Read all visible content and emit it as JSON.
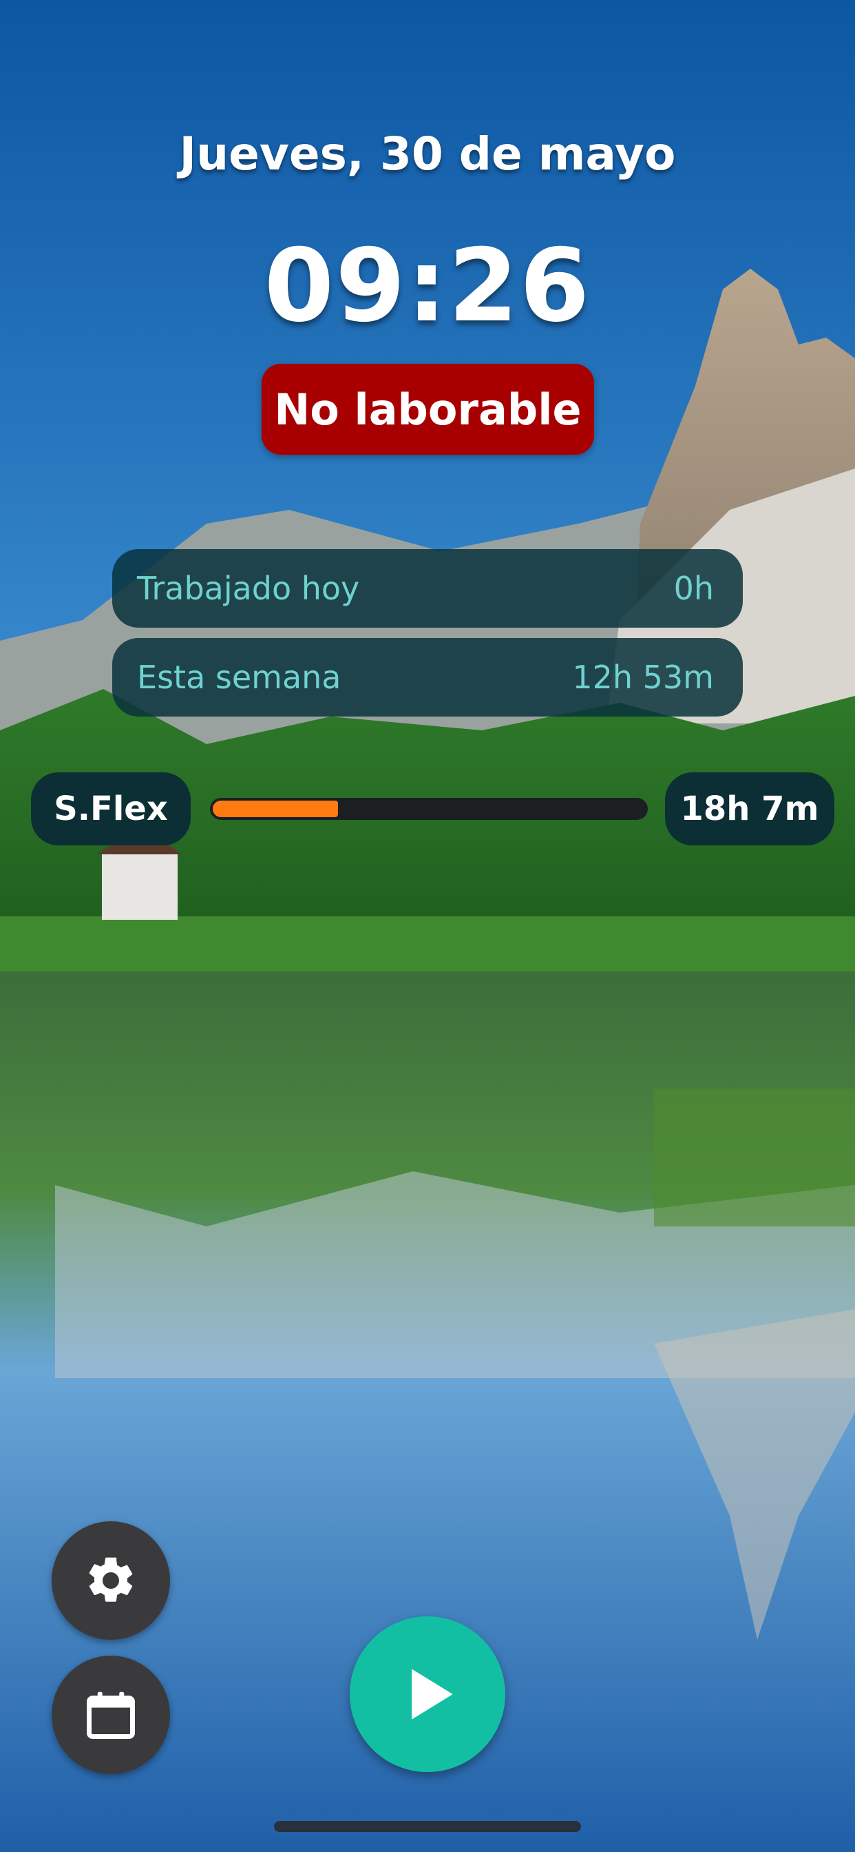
{
  "header": {
    "date": "Jueves, 30 de mayo",
    "time": "09:26",
    "status_badge": "No laborable",
    "status_color": "#a80000"
  },
  "stats": [
    {
      "label": "Trabajado hoy",
      "value": "0h"
    },
    {
      "label": "Esta semana",
      "value": "12h 53m"
    }
  ],
  "flex": {
    "label": "S.Flex",
    "value": "18h 7m",
    "progress": 0.29,
    "progress_color": "#ff7a10"
  },
  "buttons": {
    "settings_icon": "gear-icon",
    "calendar_icon": "calendar-icon",
    "play_icon": "play-icon",
    "play_color": "#13bfa3"
  }
}
